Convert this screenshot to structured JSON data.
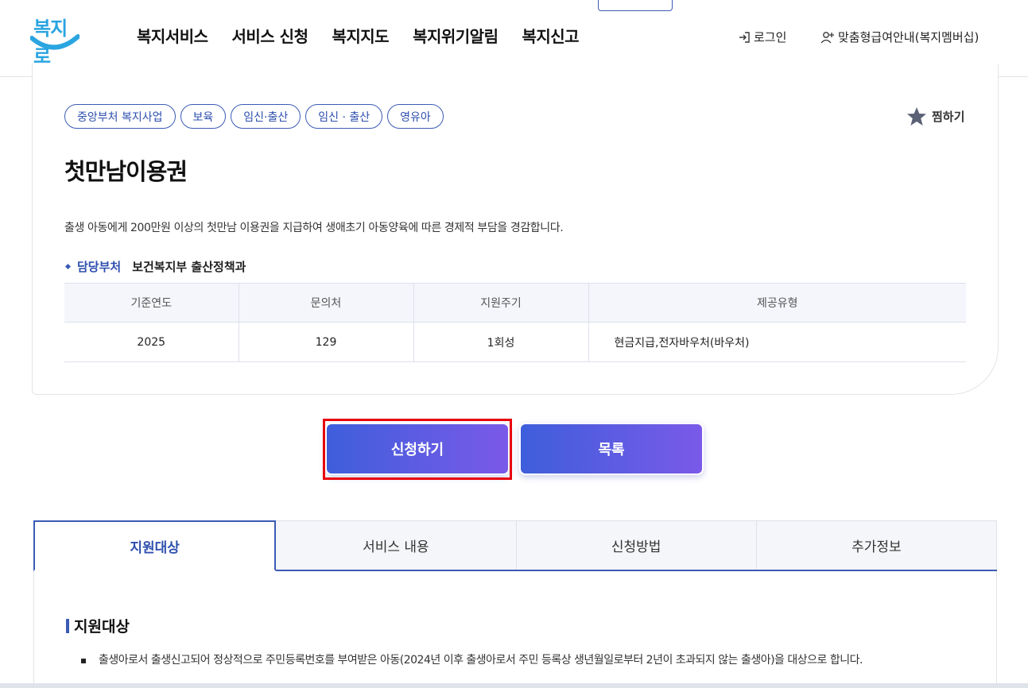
{
  "header": {
    "logo_text": "복지로",
    "nav": [
      "복지서비스",
      "서비스 신청",
      "복지지도",
      "복지위기알림",
      "복지신고"
    ],
    "login": "로그인",
    "membership": "맞춤형급여안내(복지멤버십)"
  },
  "service": {
    "tags": [
      "중앙부처 복지사업",
      "보육",
      "임신·출산",
      "임신 · 출산",
      "영유아"
    ],
    "bookmark": "찜하기",
    "title": "첫만남이용권",
    "description": "출생 아동에게 200만원 이상의 첫만남 이용권을 지급하여 생애초기 아동양육에 따른 경제적 부담을 경감합니다.",
    "dept_label": "담당부처",
    "dept_value": "보건복지부 출산정책과",
    "table": {
      "headers": [
        "기준연도",
        "문의처",
        "지원주기",
        "제공유형"
      ],
      "row": [
        "2025",
        "129",
        "1회성",
        "현금지급,전자바우처(바우처)"
      ]
    }
  },
  "buttons": {
    "apply": "신청하기",
    "list": "목록"
  },
  "tabs": [
    "지원대상",
    "서비스 내용",
    "신청방법",
    "추가정보"
  ],
  "section": {
    "title": "지원대상",
    "bullet": "출생아로서 출생신고되어 정상적으로 주민등록번호를 부여받은 아동(2024년 이후 출생아로서 주민 등록상 생년월일로부터 2년이 초과되지 않는 출생아)을 대상으로 합니다."
  },
  "colors": {
    "primary": "#3b5bb5",
    "button_gradient_start": "#3e5edb",
    "button_gradient_end": "#7a5ae8",
    "highlight": "#e8000b"
  }
}
